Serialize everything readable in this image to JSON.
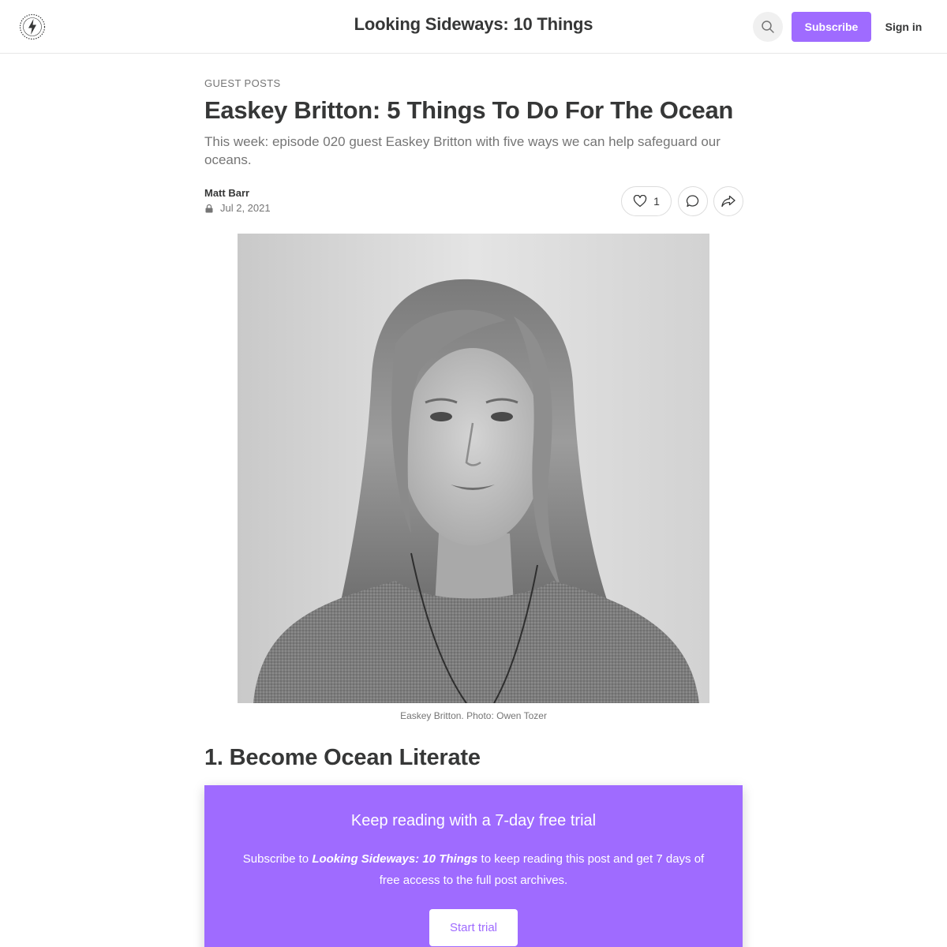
{
  "header": {
    "site_title": "Looking Sideways: 10 Things",
    "subscribe_label": "Subscribe",
    "signin_label": "Sign in",
    "logo_icon": "lightning-bolt-badge-icon",
    "search_icon": "search-icon"
  },
  "post": {
    "section": "GUEST POSTS",
    "title": "Easkey Britton: 5 Things To Do For The Ocean",
    "subtitle": "This week: episode 020 guest Easkey Britton with five ways we can help safeguard our oceans.",
    "author": "Matt Barr",
    "date": "Jul 2, 2021",
    "like_count": "1",
    "photo_caption": "Easkey Britton. Photo: Owen Tozer",
    "first_heading": "1. Become Ocean Literate"
  },
  "paywall": {
    "title": "Keep reading with a 7-day free trial",
    "body_prefix": "Subscribe to ",
    "body_pub": "Looking Sideways: 10 Things",
    "body_suffix": " to keep reading this post and get 7 days of free access to the full post archives.",
    "button_label": "Start trial"
  },
  "colors": {
    "accent": "#9f6bff",
    "text": "#363737",
    "muted": "#757575"
  }
}
